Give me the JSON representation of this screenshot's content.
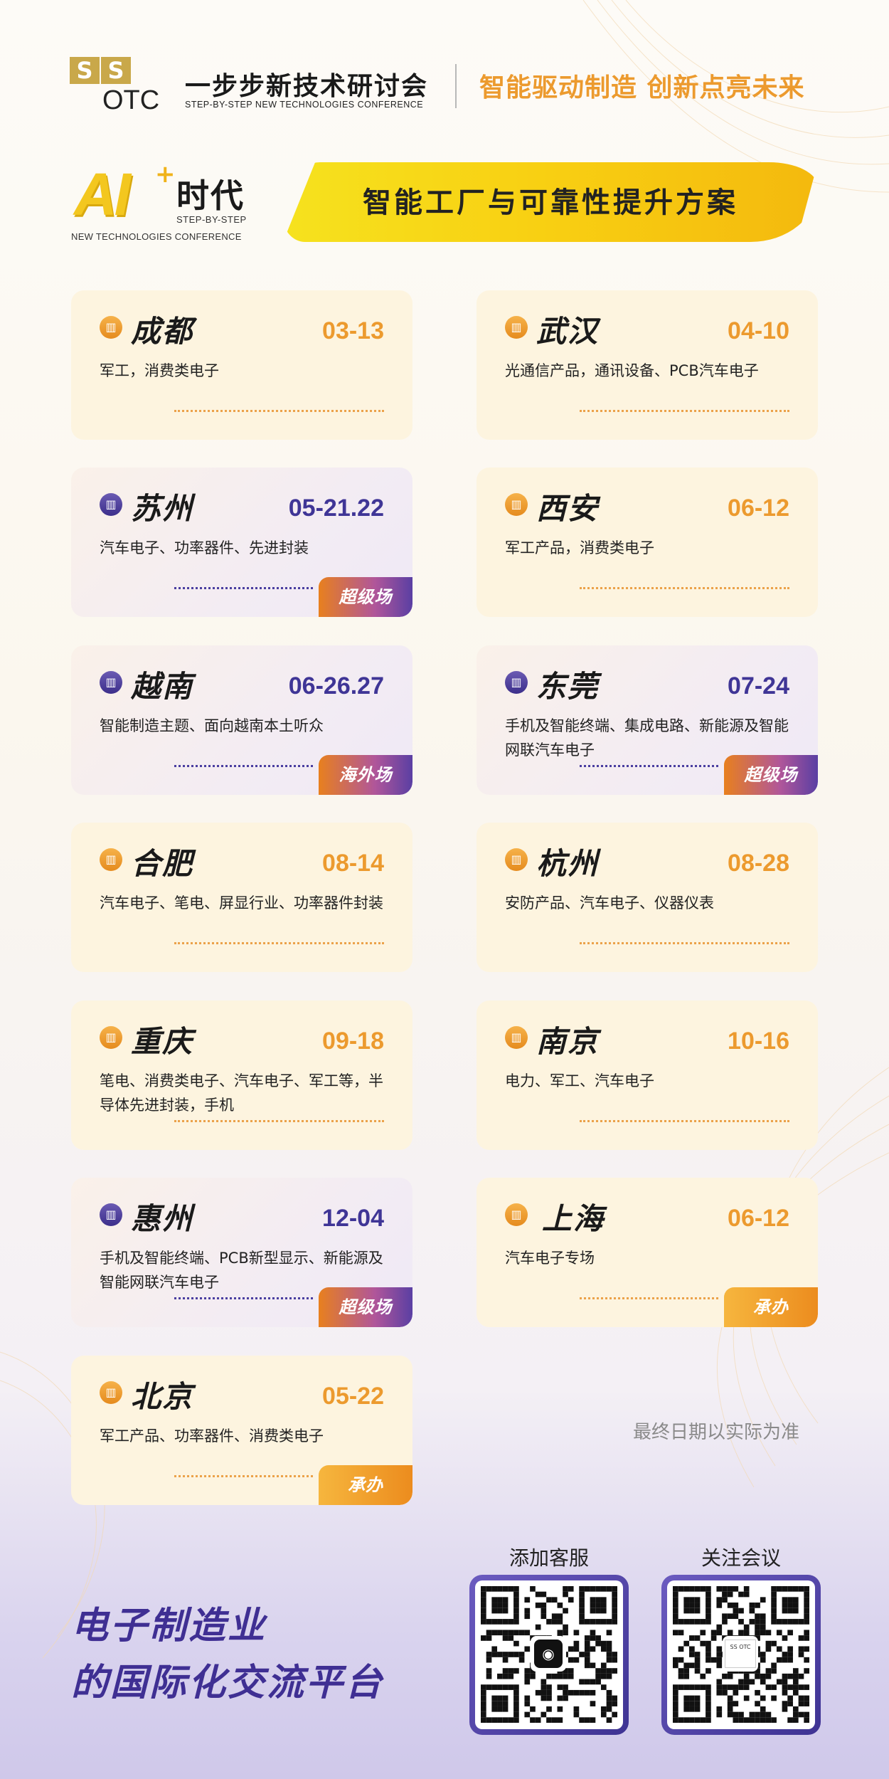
{
  "header": {
    "logo_letters": [
      "S",
      "S"
    ],
    "logo_otc": "OTC",
    "brand_cn": "一步步新技术研讨会",
    "brand_en": "STEP-BY-STEP NEW TECHNOLOGIES CONFERENCE",
    "slogan": "智能驱动制造 创新点亮未来"
  },
  "banner": {
    "ai": "AI",
    "plus": "+",
    "era": "时代",
    "en_line1": "STEP-BY-STEP",
    "en_line2": "NEW TECHNOLOGIES CONFERENCE",
    "title": "智能工厂与可靠性提升方案"
  },
  "cards": [
    {
      "city": "成都",
      "date": "03-13",
      "desc": "军工，消费类电子",
      "style": "orange",
      "tag": ""
    },
    {
      "city": "武汉",
      "date": "04-10",
      "desc": "光通信产品，通讯设备、PCB汽车电子",
      "style": "orange",
      "tag": ""
    },
    {
      "city": "苏州",
      "date": "05-21.22",
      "desc": "汽车电子、功率器件、先进封装",
      "style": "purple",
      "tag": "超级场"
    },
    {
      "city": "西安",
      "date": "06-12",
      "desc": "军工产品，消费类电子",
      "style": "orange",
      "tag": ""
    },
    {
      "city": "越南",
      "date": "06-26.27",
      "desc": "智能制造主题、面向越南本土听众",
      "style": "purple",
      "tag": "海外场"
    },
    {
      "city": "东莞",
      "date": "07-24",
      "desc": "手机及智能终端、集成电路、新能源及智能网联汽车电子",
      "style": "purple",
      "tag": "超级场"
    },
    {
      "city": "合肥",
      "date": "08-14",
      "desc": "汽车电子、笔电、屏显行业、功率器件封装",
      "style": "orange",
      "tag": ""
    },
    {
      "city": "杭州",
      "date": "08-28",
      "desc": "安防产品、汽车电子、仪器仪表",
      "style": "orange",
      "tag": ""
    },
    {
      "city": "重庆",
      "date": "09-18",
      "desc": "笔电、消费类电子、汽车电子、军工等，半导体先进封装，手机",
      "style": "orange",
      "tag": ""
    },
    {
      "city": "南京",
      "date": "10-16",
      "desc": "电力、军工、汽车电子",
      "style": "orange",
      "tag": ""
    },
    {
      "city": "惠州",
      "date": "12-04",
      "desc": "手机及智能终端、PCB新型显示、新能源及智能网联汽车电子",
      "style": "purple",
      "tag": "超级场"
    },
    {
      "city": "上海",
      "date": "06-12",
      "desc": "汽车电子专场",
      "style": "orange",
      "tag": "承办"
    },
    {
      "city": "北京",
      "date": "05-22",
      "desc": "军工产品、功率器件、消费类电子",
      "style": "orange",
      "tag": "承办"
    }
  ],
  "final_note": "最终日期以实际为准",
  "bottom": {
    "line1": "电子制造业",
    "line2": "的国际化交流平台",
    "qr1_label": "添加客服",
    "qr2_label": "关注会议"
  },
  "colors": {
    "accent_orange": "#ec9a2e",
    "accent_purple": "#3f3596",
    "banner_yellow": "#f8cf12"
  },
  "icons": [
    "building-pin-icon",
    "wechat-icon"
  ]
}
